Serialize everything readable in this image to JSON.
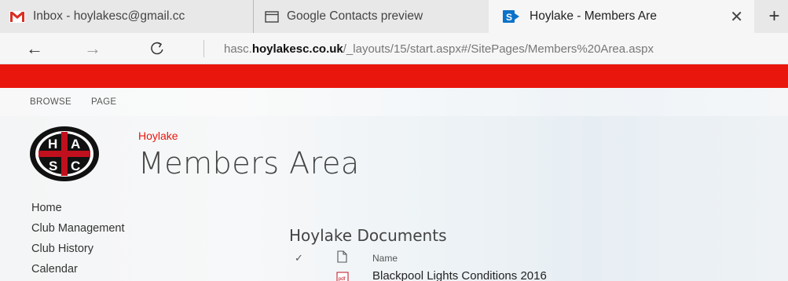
{
  "browser": {
    "tabs": [
      {
        "icon": "gmail-icon",
        "label": "Inbox - hoylakesc@gmail.cc"
      },
      {
        "icon": "window-icon",
        "label": "Google Contacts preview"
      },
      {
        "icon": "sharepoint-icon",
        "label": "Hoylake - Members Are",
        "close": "✕"
      }
    ],
    "new_tab": "+",
    "back": "←",
    "forward": "→",
    "refresh": "↻",
    "url": {
      "prefix": "hasc.",
      "host": "hoylakesc.co.uk",
      "path": "/_layouts/15/start.aspx#/SitePages/Members%20Area.aspx"
    }
  },
  "colors": {
    "suite_bar": "#e8160c",
    "accent": "#e8160c"
  },
  "ribbon": {
    "tabs": [
      "BROWSE",
      "PAGE"
    ]
  },
  "site": {
    "logo_letters": [
      "H",
      "A",
      "S",
      "C"
    ],
    "subtitle": "Hoylake",
    "title": "Members Area"
  },
  "quick_launch": [
    "Home",
    "Club Management",
    "Club History",
    "Calendar"
  ],
  "documents": {
    "title": "Hoylake Documents",
    "check_col": "✓",
    "name_col": "Name",
    "rows": [
      {
        "type": "pdf",
        "name": "Blackpool Lights Conditions 2016"
      }
    ]
  }
}
